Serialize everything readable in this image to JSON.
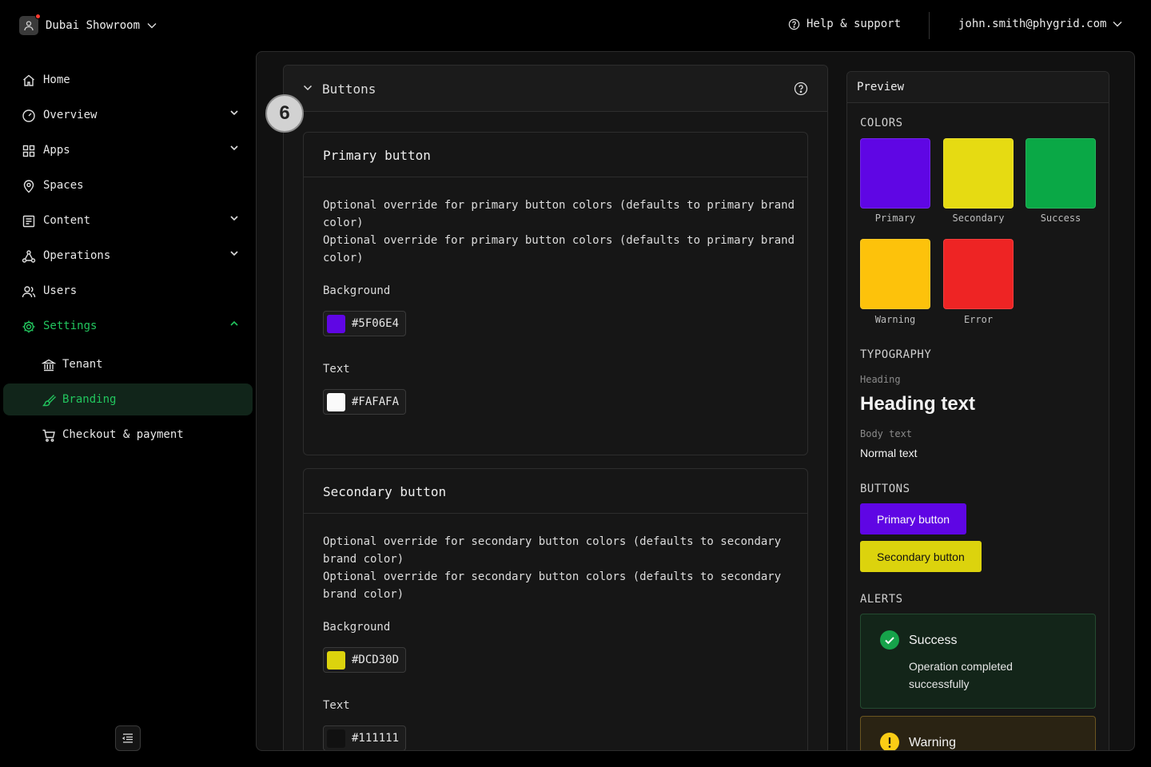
{
  "topbar": {
    "tenant_name": "Dubai Showroom",
    "help_label": "Help & support",
    "user_email": "john.smith@phygrid.com"
  },
  "sidebar": {
    "items": [
      {
        "label": "Home",
        "icon": "home-icon"
      },
      {
        "label": "Overview",
        "icon": "gauge-icon",
        "expandable": true
      },
      {
        "label": "Apps",
        "icon": "grid-icon",
        "expandable": true
      },
      {
        "label": "Spaces",
        "icon": "location-pin-icon"
      },
      {
        "label": "Content",
        "icon": "document-list-icon",
        "expandable": true
      },
      {
        "label": "Operations",
        "icon": "network-icon",
        "expandable": true
      },
      {
        "label": "Users",
        "icon": "users-icon"
      },
      {
        "label": "Settings",
        "icon": "gear-icon",
        "expanded": true
      }
    ],
    "settings_children": [
      {
        "label": "Tenant",
        "icon": "bank-icon"
      },
      {
        "label": "Branding",
        "icon": "brush-icon",
        "active": true
      },
      {
        "label": "Checkout & payment",
        "icon": "cart-icon"
      }
    ]
  },
  "section": {
    "title": "Buttons",
    "step_number": "6"
  },
  "primary_card": {
    "title": "Primary button",
    "description_lines": [
      "Optional override for primary button colors (defaults to primary brand color)",
      "Optional override for primary button colors (defaults to primary brand color)"
    ],
    "background_label": "Background",
    "background_value": "#5F06E4",
    "text_label": "Text",
    "text_value": "#FAFAFA"
  },
  "secondary_card": {
    "title": "Secondary button",
    "description_lines": [
      "Optional override for secondary button colors (defaults to secondary brand color)",
      "Optional override for secondary button colors (defaults to secondary brand color)"
    ],
    "background_label": "Background",
    "background_value": "#DCD30D",
    "text_label": "Text",
    "text_value": "#111111"
  },
  "preview": {
    "title": "Preview",
    "colors_heading": "COLORS",
    "colors": [
      {
        "label": "Primary",
        "hex": "#5F06E4"
      },
      {
        "label": "Secondary",
        "hex": "#E6DB12"
      },
      {
        "label": "Success",
        "hex": "#0AA846"
      },
      {
        "label": "Warning",
        "hex": "#FDC20B"
      },
      {
        "label": "Error",
        "hex": "#EE2424"
      }
    ],
    "typography_heading": "TYPOGRAPHY",
    "heading_caption": "Heading",
    "heading_sample": "Heading text",
    "body_caption": "Body text",
    "body_sample": "Normal text",
    "buttons_heading": "BUTTONS",
    "primary_button_label": "Primary button",
    "secondary_button_label": "Secondary button",
    "alerts_heading": "ALERTS",
    "alerts": {
      "success_title": "Success",
      "success_message": "Operation completed successfully",
      "warning_title": "Warning"
    }
  },
  "colors": {
    "accent_green": "#22C55E",
    "primary_button_bg": "#5F06E4",
    "primary_button_text": "#FAFAFA",
    "secondary_button_bg": "#DCD30D",
    "secondary_button_text": "#111111"
  }
}
